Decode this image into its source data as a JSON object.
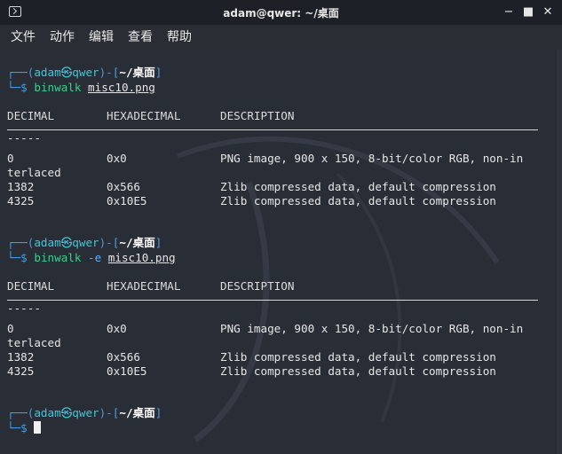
{
  "window": {
    "title": "adam@qwer: ~/桌面",
    "controls": [
      "−",
      "■",
      "✕"
    ]
  },
  "menubar": [
    "文件",
    "动作",
    "编辑",
    "查看",
    "帮助"
  ],
  "prompt": {
    "user": "adam",
    "host": "qwer",
    "path": "~/桌面",
    "symbol": "$"
  },
  "commands": [
    {
      "cmd": "binwalk",
      "opt": "",
      "arg": "misc10.png"
    },
    {
      "cmd": "binwalk",
      "opt": "-e",
      "arg": "misc10.png"
    }
  ],
  "table": {
    "headers": [
      "DECIMAL",
      "HEXADECIMAL",
      "DESCRIPTION"
    ],
    "short_rule": "-----",
    "rows": [
      {
        "decimal": "0",
        "hex": "0x0",
        "desc": "PNG image, 900 x 150, 8-bit/color RGB, non-in"
      },
      {
        "decimal": "terlaced",
        "hex": "",
        "desc": ""
      },
      {
        "decimal": "1382",
        "hex": "0x566",
        "desc": "Zlib compressed data, default compression"
      },
      {
        "decimal": "4325",
        "hex": "0x10E5",
        "desc": "Zlib compressed data, default compression"
      }
    ]
  },
  "colors": {
    "prompt_frame": "#4a9be6",
    "prompt_user": "#45c6d6",
    "command": "#34d38a",
    "background": "#292d36"
  }
}
